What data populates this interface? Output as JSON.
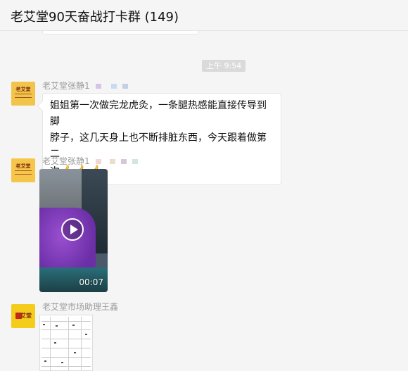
{
  "header": {
    "title": "老艾堂90天奋战打卡群 (149)"
  },
  "divider": {
    "time": "上午 9:54"
  },
  "messages": [
    {
      "sender": "老艾堂张静1",
      "avatar_text": "老艾堂",
      "text_line1": "姐姐第一次做完龙虎灸，一条腿热感能直接传导到脚",
      "text_line2": "脖子，这几天身上也不断排脏东西，今天跟着做第二",
      "text_line3": "次",
      "emoji": "👍👍👍"
    },
    {
      "sender": "老艾堂张静1",
      "avatar_text": "老艾堂",
      "video_duration": "00:07"
    },
    {
      "sender": "老艾堂市场助理王鑫",
      "avatar_text": "艾堂"
    }
  ],
  "colors": {
    "accent_avatar": "#f2c54a",
    "bubble_bg": "#ffffff",
    "page_bg": "#f5f5f5",
    "divider_bg": "#dadada"
  },
  "icons": [
    "play-icon",
    "thumbs-up-icon"
  ]
}
